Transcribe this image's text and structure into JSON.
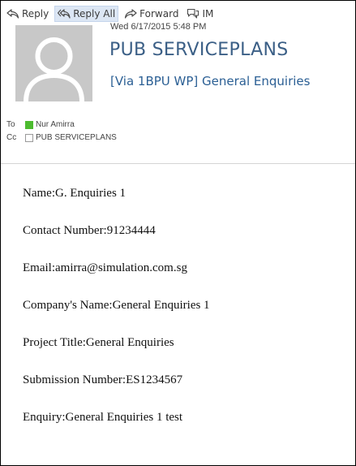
{
  "toolbar": {
    "reply_label": "Reply",
    "reply_all_label": "Reply All",
    "forward_label": "Forward",
    "im_label": "IM"
  },
  "header": {
    "date": "Wed 6/17/2015 5:48 PM",
    "sender": "PUB SERVICEPLANS",
    "subject": "[Via 1BPU WP] General Enquiries",
    "to_label": "To",
    "to_name": "Nur Amirra",
    "to_presence_color": "#4cbb2f",
    "cc_label": "Cc",
    "cc_name": "PUB SERVICEPLANS"
  },
  "body": {
    "lines": [
      "Name:G. Enquiries 1",
      "Contact Number:91234444",
      "Email:amirra@simulation.com.sg",
      "Company's Name:General Enquiries 1",
      "Project Title:General Enquiries",
      "Submission Number:ES1234567",
      "Enquiry:General Enquiries 1 test"
    ]
  },
  "colors": {
    "sender_text": "#3b5f86",
    "subject_text": "#2b5f94",
    "active_button_bg": "#dce6f4"
  }
}
